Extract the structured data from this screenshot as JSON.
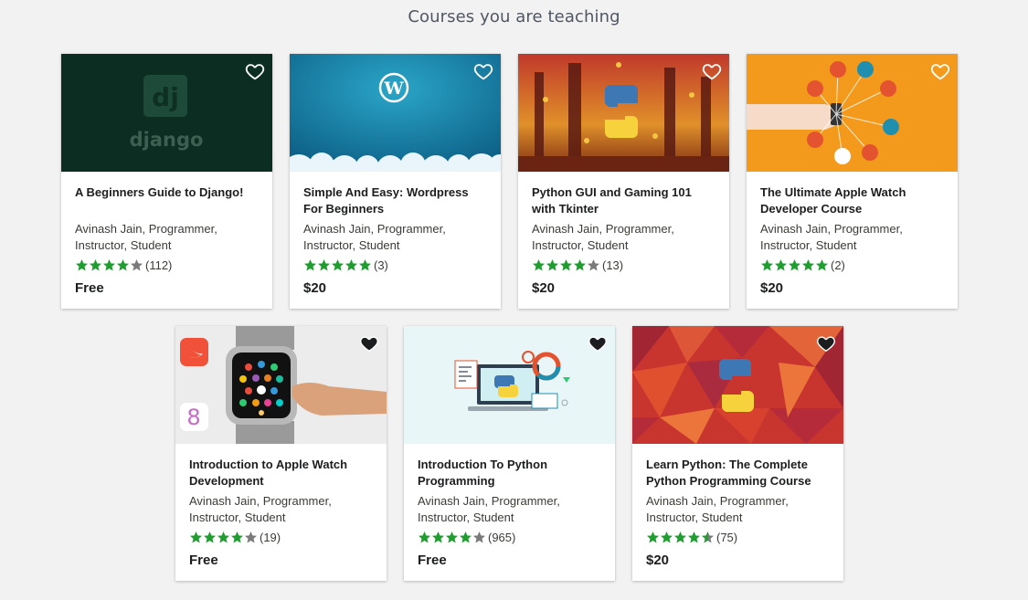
{
  "heading": "Courses you are teaching",
  "colors": {
    "star_green": "#1e9e2e",
    "star_gray": "#7a7a7a"
  },
  "courses": [
    {
      "title": "A Beginners Guide to Django!",
      "instructor": "Avinash Jain, Programmer, Instructor, Student",
      "rating": 4,
      "count": "(112)",
      "price": "Free",
      "wishlisted": false,
      "image": "django",
      "logo_text": "dj",
      "logo_word": "django"
    },
    {
      "title": "Simple And Easy: Wordpress For Beginners",
      "instructor": "Avinash Jain, Programmer, Instructor, Student",
      "rating": 5,
      "count": "(3)",
      "price": "$20",
      "wishlisted": false,
      "image": "wordpress"
    },
    {
      "title": "Python GUI and Gaming 101 with Tkinter",
      "instructor": "Avinash Jain, Programmer, Instructor, Student",
      "rating": 4,
      "count": "(13)",
      "price": "$20",
      "wishlisted": false,
      "image": "python-forest"
    },
    {
      "title": "The Ultimate Apple Watch Developer Course",
      "instructor": "Avinash Jain, Programmer, Instructor, Student",
      "rating": 5,
      "count": "(2)",
      "price": "$20",
      "wishlisted": false,
      "image": "apple-watch-orange"
    },
    {
      "title": "Introduction to Apple Watch Development",
      "instructor": "Avinash Jain, Programmer, Instructor, Student",
      "rating": 4,
      "count": "(19)",
      "price": "Free",
      "wishlisted": true,
      "image": "apple-watch-hand"
    },
    {
      "title": "Introduction To Python Programming",
      "instructor": "Avinash Jain, Programmer, Instructor, Student",
      "rating": 4,
      "count": "(965)",
      "price": "Free",
      "wishlisted": true,
      "image": "python-laptop"
    },
    {
      "title": "Learn Python: The Complete Python Programming Course",
      "instructor": "Avinash Jain, Programmer, Instructor, Student",
      "rating": 4.5,
      "count": "(75)",
      "price": "$20",
      "wishlisted": true,
      "image": "python-red"
    }
  ]
}
